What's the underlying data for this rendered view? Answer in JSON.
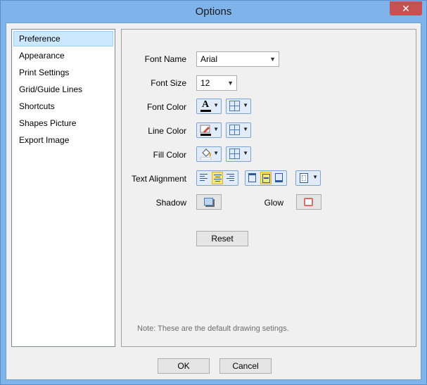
{
  "window": {
    "title": "Options",
    "close_glyph": "✕"
  },
  "sidebar": {
    "items": [
      {
        "label": "Preference",
        "selected": true
      },
      {
        "label": "Appearance"
      },
      {
        "label": "Print Settings"
      },
      {
        "label": "Grid/Guide Lines"
      },
      {
        "label": "Shortcuts"
      },
      {
        "label": "Shapes Picture"
      },
      {
        "label": "Export Image"
      }
    ]
  },
  "preference": {
    "font_name": {
      "label": "Font Name",
      "value": "Arial"
    },
    "font_size": {
      "label": "Font Size",
      "value": "12"
    },
    "font_color": {
      "label": "Font Color",
      "glyph": "A",
      "color": "#000000"
    },
    "line_color": {
      "label": "Line Color",
      "color": "#000000"
    },
    "fill_color": {
      "label": "Fill Color",
      "color": "#ffffff"
    },
    "text_alignment": {
      "label": "Text Alignment",
      "horizontal_selected": "center",
      "vertical_selected": "middle"
    },
    "shadow": {
      "label": "Shadow"
    },
    "glow": {
      "label": "Glow",
      "color": "#e06a6a"
    },
    "reset_label": "Reset",
    "note": "Note: These are the default drawing setings."
  },
  "footer": {
    "ok_label": "OK",
    "cancel_label": "Cancel"
  },
  "icons": {
    "dropdown": "chevron-down-icon",
    "font_color": "font-color-icon",
    "line_color": "pen-icon",
    "fill_color": "paint-bucket-icon",
    "grid": "grid-icon",
    "shadow": "shadow-icon",
    "glow": "glow-icon"
  },
  "colors": {
    "titlebar": "#7eb4ea",
    "selection": "#cce8ff",
    "close": "#c75050"
  }
}
